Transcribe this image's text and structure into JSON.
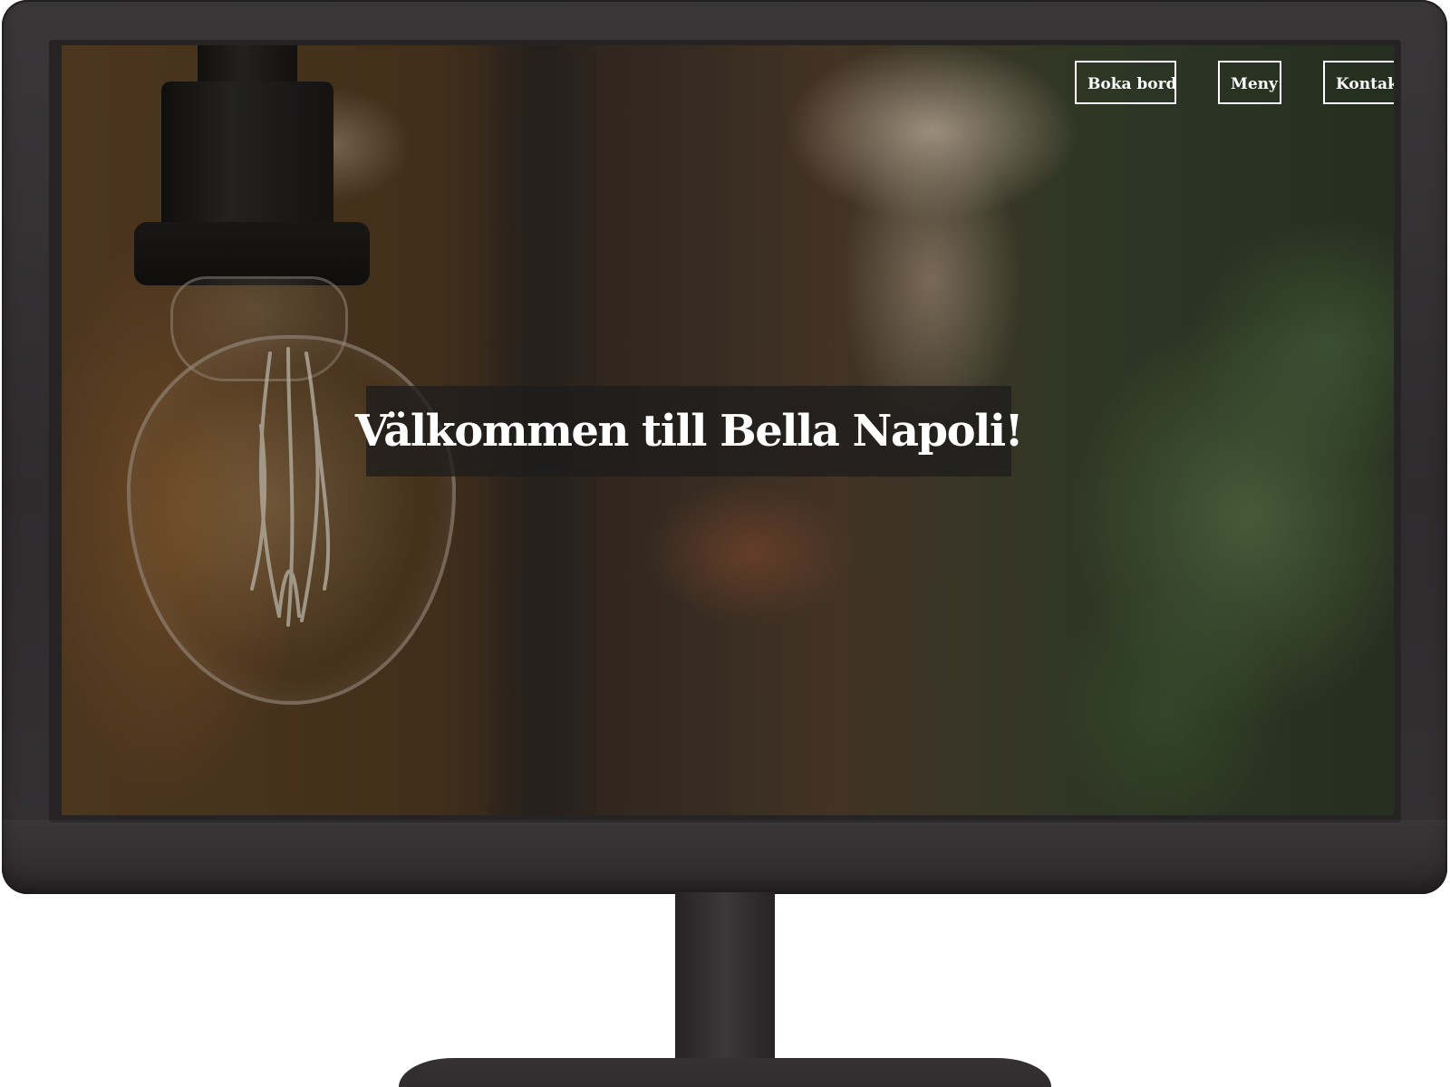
{
  "nav": {
    "items": [
      {
        "label": "Boka bord"
      },
      {
        "label": "Meny"
      },
      {
        "label": "Kontakt"
      }
    ]
  },
  "hero": {
    "title": "Välkommen till Bella Napoli!",
    "background_image": "light-bulb-restaurant-photo"
  },
  "colors": {
    "nav_text": "#ffffff",
    "headline_box": "#1e1c1c",
    "monitor_frame": "#302d2f"
  }
}
